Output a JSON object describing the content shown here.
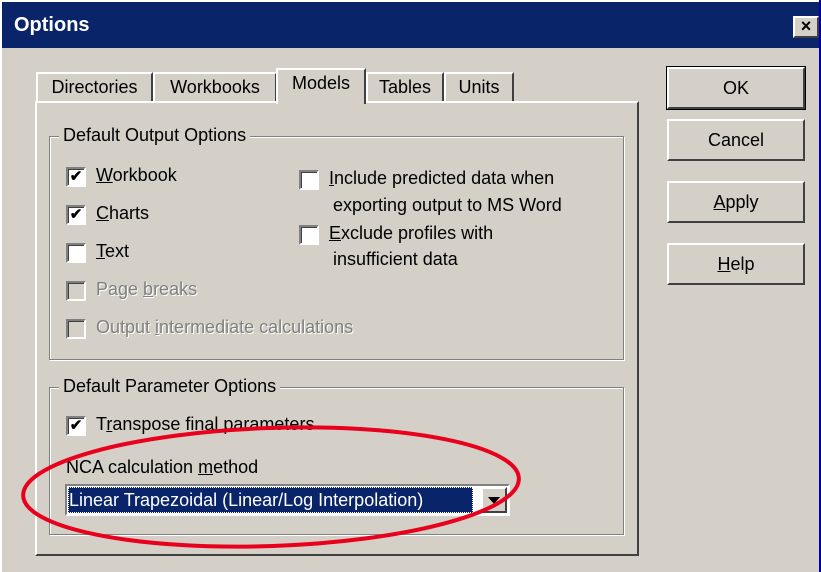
{
  "window": {
    "title": "Options",
    "close_glyph": "×"
  },
  "tabs": [
    {
      "label": "Directories",
      "active": false
    },
    {
      "label": "Workbooks",
      "active": false
    },
    {
      "label": "Models",
      "active": true
    },
    {
      "label": "Tables",
      "active": false
    },
    {
      "label": "Units",
      "active": false
    }
  ],
  "output_options": {
    "title": "Default Output Options",
    "workbook": {
      "label": "Workbook",
      "checked": true
    },
    "charts": {
      "label": "Charts",
      "checked": true
    },
    "text": {
      "label": "Text",
      "checked": false
    },
    "page_breaks": {
      "label": "Page breaks",
      "checked": false,
      "disabled": true
    },
    "intermediate": {
      "label": "Output intermediate calculations",
      "checked": false,
      "disabled": true
    },
    "include_predicted": {
      "label_line1": "Include predicted data when",
      "label_line2": "exporting output to MS Word",
      "checked": false
    },
    "exclude_profiles": {
      "label_line1": "Exclude profiles with",
      "label_line2": "insufficient data",
      "checked": false
    }
  },
  "parameter_options": {
    "title": "Default Parameter Options",
    "transpose": {
      "label": "Transpose final parameters",
      "checked": true
    },
    "nca_label": "NCA calculation method",
    "nca_value": "Linear Trapezoidal (Linear/Log Interpolation)"
  },
  "buttons": {
    "ok": "OK",
    "cancel": "Cancel",
    "apply": "Apply",
    "help": "Help"
  },
  "check_glyph": "✔",
  "colors": {
    "desktop": "#0000a8",
    "titlebar": "#0a246a",
    "dialog": "#d4d0c8",
    "highlight_ellipse": "#e8001c",
    "selection": "#0a246a"
  }
}
